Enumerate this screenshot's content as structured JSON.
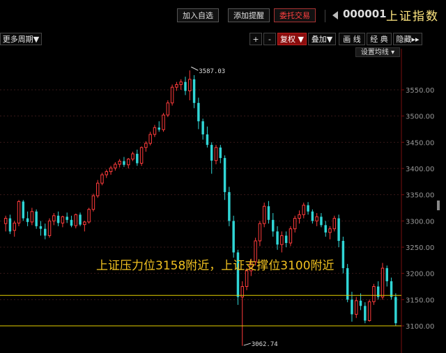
{
  "toolbar_top": {
    "add_watch": "加入自选",
    "add_alert": "添加提醒",
    "trade": "委托交易",
    "code": "000001",
    "name": "上证指数"
  },
  "toolbar_chart": {
    "more_period": "更多周期▼",
    "plus": "+",
    "minus": "-",
    "restore": "复权 ▼",
    "overlay": "叠加▼",
    "draw_line": "画 线",
    "classic": "经 典",
    "hide": "隐藏▸▸",
    "settings": "设置均线 ▾"
  },
  "chart_data": {
    "type": "candlestick",
    "y_ticks": [
      "3550.00",
      "3500.00",
      "3450.00",
      "3400.00",
      "3350.00",
      "3300.00",
      "3250.00",
      "3200.00",
      "3150.00",
      "3100.00"
    ],
    "ylim": [
      3085,
      3600
    ],
    "high_label": "3587.03",
    "low_label": "3062.74",
    "annotation": "上证压力位3158附近，上证支撑位3100附近",
    "resistance": 3158,
    "support": 3100,
    "colors": {
      "up": "#ff3b3b",
      "down": "#30d6d6",
      "line": "#e6d000",
      "grid": "#3a1a1a",
      "axis": "#7a1010",
      "annotation": "#f0c020"
    },
    "candles": [
      [
        3295,
        3310,
        3280,
        3305
      ],
      [
        3305,
        3312,
        3275,
        3280
      ],
      [
        3282,
        3300,
        3270,
        3296
      ],
      [
        3296,
        3340,
        3290,
        3337
      ],
      [
        3337,
        3340,
        3300,
        3305
      ],
      [
        3305,
        3318,
        3290,
        3298
      ],
      [
        3298,
        3325,
        3292,
        3318
      ],
      [
        3318,
        3322,
        3285,
        3290
      ],
      [
        3290,
        3300,
        3272,
        3285
      ],
      [
        3285,
        3295,
        3265,
        3272
      ],
      [
        3272,
        3305,
        3268,
        3300
      ],
      [
        3300,
        3315,
        3292,
        3310
      ],
      [
        3310,
        3318,
        3290,
        3296
      ],
      [
        3296,
        3310,
        3288,
        3308
      ],
      [
        3308,
        3316,
        3296,
        3302
      ],
      [
        3302,
        3310,
        3288,
        3291
      ],
      [
        3291,
        3314,
        3286,
        3312
      ],
      [
        3312,
        3316,
        3290,
        3293
      ],
      [
        3293,
        3300,
        3280,
        3298
      ],
      [
        3298,
        3325,
        3295,
        3322
      ],
      [
        3322,
        3352,
        3318,
        3348
      ],
      [
        3348,
        3378,
        3344,
        3372
      ],
      [
        3372,
        3392,
        3368,
        3388
      ],
      [
        3388,
        3398,
        3382,
        3394
      ],
      [
        3394,
        3405,
        3388,
        3401
      ],
      [
        3401,
        3412,
        3396,
        3408
      ],
      [
        3408,
        3418,
        3402,
        3414
      ],
      [
        3414,
        3422,
        3403,
        3407
      ],
      [
        3407,
        3420,
        3400,
        3418
      ],
      [
        3418,
        3432,
        3414,
        3428
      ],
      [
        3428,
        3436,
        3405,
        3410
      ],
      [
        3410,
        3442,
        3405,
        3440
      ],
      [
        3440,
        3452,
        3432,
        3448
      ],
      [
        3448,
        3470,
        3444,
        3465
      ],
      [
        3465,
        3483,
        3460,
        3478
      ],
      [
        3478,
        3490,
        3470,
        3474
      ],
      [
        3474,
        3506,
        3470,
        3502
      ],
      [
        3502,
        3530,
        3498,
        3525
      ],
      [
        3525,
        3560,
        3520,
        3555
      ],
      [
        3555,
        3565,
        3548,
        3560
      ],
      [
        3560,
        3570,
        3550,
        3565
      ],
      [
        3565,
        3575,
        3540,
        3548
      ],
      [
        3548,
        3587,
        3530,
        3570
      ],
      [
        3570,
        3578,
        3515,
        3525
      ],
      [
        3525,
        3535,
        3475,
        3490
      ],
      [
        3490,
        3495,
        3455,
        3465
      ],
      [
        3465,
        3480,
        3440,
        3445
      ],
      [
        3445,
        3450,
        3390,
        3415
      ],
      [
        3415,
        3445,
        3408,
        3440
      ],
      [
        3440,
        3445,
        3410,
        3420
      ],
      [
        3420,
        3425,
        3340,
        3355
      ],
      [
        3355,
        3365,
        3290,
        3300
      ],
      [
        3300,
        3310,
        3230,
        3240
      ],
      [
        3240,
        3245,
        3140,
        3155
      ],
      [
        3155,
        3185,
        3062,
        3175
      ],
      [
        3175,
        3210,
        3168,
        3205
      ],
      [
        3205,
        3228,
        3195,
        3222
      ],
      [
        3222,
        3268,
        3215,
        3262
      ],
      [
        3262,
        3300,
        3252,
        3295
      ],
      [
        3295,
        3335,
        3288,
        3328
      ],
      [
        3328,
        3338,
        3295,
        3302
      ],
      [
        3302,
        3315,
        3270,
        3280
      ],
      [
        3280,
        3290,
        3245,
        3255
      ],
      [
        3255,
        3280,
        3240,
        3272
      ],
      [
        3272,
        3280,
        3250,
        3258
      ],
      [
        3258,
        3290,
        3252,
        3285
      ],
      [
        3285,
        3310,
        3278,
        3305
      ],
      [
        3305,
        3320,
        3295,
        3312
      ],
      [
        3312,
        3335,
        3305,
        3330
      ],
      [
        3330,
        3336,
        3312,
        3318
      ],
      [
        3318,
        3322,
        3295,
        3300
      ],
      [
        3300,
        3315,
        3290,
        3308
      ],
      [
        3308,
        3315,
        3288,
        3292
      ],
      [
        3292,
        3300,
        3270,
        3278
      ],
      [
        3278,
        3290,
        3265,
        3285
      ],
      [
        3285,
        3310,
        3280,
        3305
      ],
      [
        3305,
        3312,
        3250,
        3262
      ],
      [
        3262,
        3270,
        3200,
        3210
      ],
      [
        3210,
        3218,
        3145,
        3150
      ],
      [
        3150,
        3165,
        3108,
        3122
      ],
      [
        3122,
        3155,
        3115,
        3148
      ],
      [
        3148,
        3162,
        3130,
        3138
      ],
      [
        3138,
        3145,
        3105,
        3110
      ],
      [
        3110,
        3150,
        3108,
        3146
      ],
      [
        3146,
        3180,
        3140,
        3175
      ],
      [
        3175,
        3185,
        3150,
        3155
      ],
      [
        3155,
        3220,
        3150,
        3210
      ],
      [
        3210,
        3215,
        3175,
        3185
      ],
      [
        3185,
        3192,
        3150,
        3155
      ],
      [
        3155,
        3162,
        3100,
        3105
      ]
    ]
  }
}
